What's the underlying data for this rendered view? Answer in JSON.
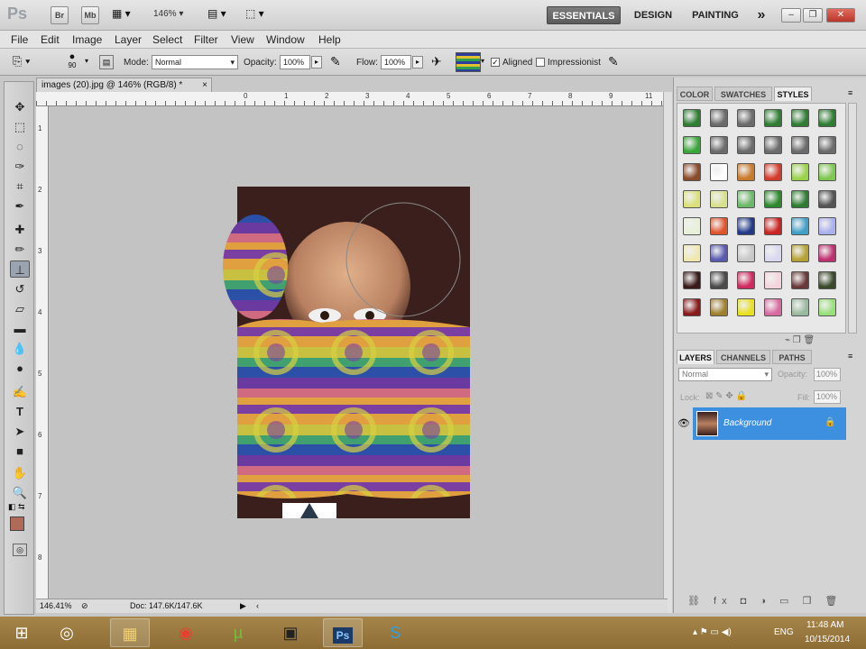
{
  "app": {
    "logo": "Ps",
    "bridge_label": "Br",
    "minibridge_label": "Mb",
    "zoom_level": "146%"
  },
  "workspaces": {
    "essentials": "ESSENTIALS",
    "design": "DESIGN",
    "painting": "PAINTING",
    "more": "»"
  },
  "window_controls": {
    "minimize": "–",
    "restore": "❐",
    "close": "✕"
  },
  "menu": [
    "File",
    "Edit",
    "Image",
    "Layer",
    "Select",
    "Filter",
    "View",
    "Window",
    "Help"
  ],
  "options": {
    "brush_size": "90",
    "mode_label": "Mode:",
    "mode_value": "Normal",
    "opacity_label": "Opacity:",
    "opacity_value": "100%",
    "flow_label": "Flow:",
    "flow_value": "100%",
    "aligned_label": "Aligned",
    "aligned_checked": true,
    "impressionist_label": "Impressionist",
    "impressionist_checked": false
  },
  "document": {
    "tab_title": "images (20).jpg @ 146% (RGB/8) *",
    "close": "×",
    "ruler_ticks": [
      "0",
      "1",
      "2",
      "3",
      "4",
      "5",
      "6",
      "7",
      "8",
      "9",
      "10",
      "11"
    ],
    "left_ruler_ticks": [
      "1",
      "2",
      "3",
      "4",
      "5",
      "6",
      "7",
      "8"
    ],
    "status_zoom": "146.41%",
    "status_doc": "Doc: 147.6K/147.6K"
  },
  "panels": {
    "top_tabs": [
      "COLOR",
      "SWATCHES",
      "STYLES"
    ],
    "top_active": "STYLES",
    "layer_tabs": [
      "LAYERS",
      "CHANNELS",
      "PATHS"
    ],
    "layer_active": "LAYERS",
    "blend_mode": "Normal",
    "opacity_label": "Opacity:",
    "opacity_value": "100%",
    "lock_label": "Lock:",
    "fill_label": "Fill:",
    "fill_value": "100%",
    "layer_name": "Background",
    "style_colors": [
      "#2e7d32",
      "#6b6b6b",
      "#6b6b6b",
      "#2e7d32",
      "#2e7d32",
      "#2e7d32",
      "#3aa63a",
      "#6b6b6b",
      "#6b6b6b",
      "#6b6b6b",
      "#6b6b6b",
      "#6b6b6b",
      "#8a4b2b",
      "#ffffff",
      "#c97a2a",
      "#d43b2b",
      "#9ad34a",
      "#7ec850",
      "#dbe07a",
      "#d8e08c",
      "#6cb86a",
      "#2c8a2c",
      "#2e7d32",
      "#555555",
      "#e8f0d8",
      "#e0542a",
      "#233a8a",
      "#cc2222",
      "#3fa0c8",
      "#aab0ee",
      "#f0e8b0",
      "#5a5ab0",
      "#c8c8c8",
      "#d8d8f0",
      "#b5a233",
      "#c03070",
      "#3a1a1a",
      "#4a4a4a",
      "#d02a60",
      "#f4d4dc",
      "#6a3a3a",
      "#3a4a2a",
      "#8a1a1a",
      "#a08030",
      "#e8e020",
      "#d86aa0",
      "#9abaa0",
      "#9ae07a"
    ]
  },
  "taskbar": {
    "time": "11:48 AM",
    "date": "10/15/2014",
    "lang": "ENG",
    "apps": [
      "start",
      "opera",
      "explorer",
      "chrome",
      "utorrent",
      "camtasia",
      "photoshop",
      "skype"
    ]
  }
}
